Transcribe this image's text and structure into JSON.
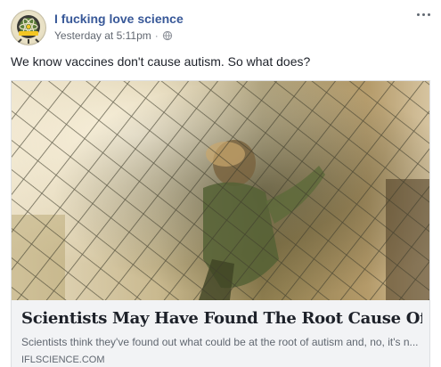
{
  "post": {
    "page_name": "I fucking love science",
    "timestamp": "Yesterday at 5:11pm",
    "separator": "·",
    "audience_icon": "globe-icon",
    "caption": "We know vaccines don't cause autism. So what does?"
  },
  "link_card": {
    "headline": "Scientists May Have Found The Root Cause Of Autism",
    "description": "Scientists think they've found out what could be at the root of autism and, no, it's n...",
    "source": "IFLSCIENCE.COM",
    "image_description": "blurred child climbing a rope net"
  },
  "colors": {
    "page_name": "#385898",
    "meta_text": "#616770",
    "card_bg": "#f2f3f5"
  }
}
